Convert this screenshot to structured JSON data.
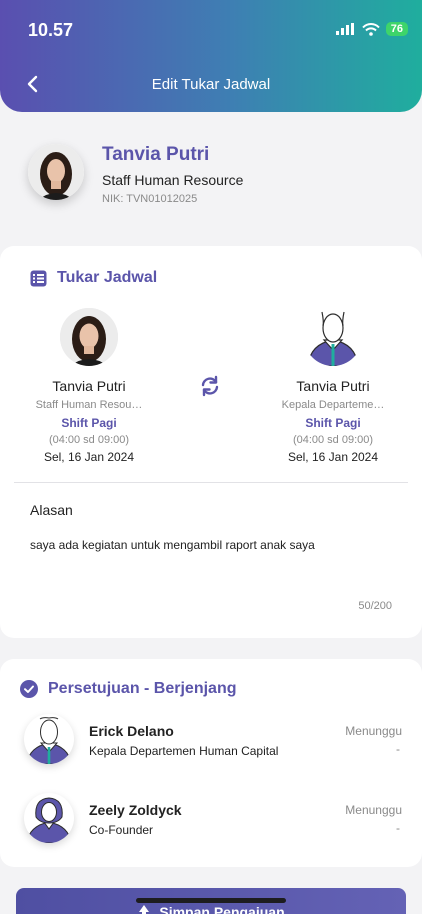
{
  "status_bar": {
    "time": "10.57",
    "battery": "76"
  },
  "header": {
    "title": "Edit Tukar Jadwal"
  },
  "profile": {
    "name": "Tanvia Putri",
    "role": "Staff Human Resource",
    "nik": "NIK: TVN01012025"
  },
  "swap": {
    "section_title": "Tukar Jadwal",
    "left": {
      "name": "Tanvia Putri",
      "role": "Staff Human Resou…",
      "shift": "Shift Pagi",
      "time": "(04:00 sd 09:00)",
      "date": "Sel, 16 Jan 2024"
    },
    "right": {
      "name": "Tanvia Putri",
      "role": "Kepala Departeme…",
      "shift": "Shift Pagi",
      "time": "(04:00 sd 09:00)",
      "date": "Sel, 16 Jan 2024"
    },
    "reason_label": "Alasan",
    "reason_text": "saya ada kegiatan untuk mengambil raport anak saya",
    "counter": "50/200"
  },
  "approval": {
    "section_title": "Persetujuan - Berjenjang",
    "items": [
      {
        "name": "Erick Delano",
        "role": "Kepala Departemen Human Capital",
        "status": "Menunggu",
        "note": "-"
      },
      {
        "name": "Zeely Zoldyck",
        "role": "Co-Founder",
        "status": "Menunggu",
        "note": "-"
      }
    ]
  },
  "submit": {
    "label": "Simpan Pengajuan"
  },
  "colors": {
    "accent": "#5b55aa",
    "gradient_start": "#5a4fb0",
    "gradient_end": "#1fae9e"
  }
}
